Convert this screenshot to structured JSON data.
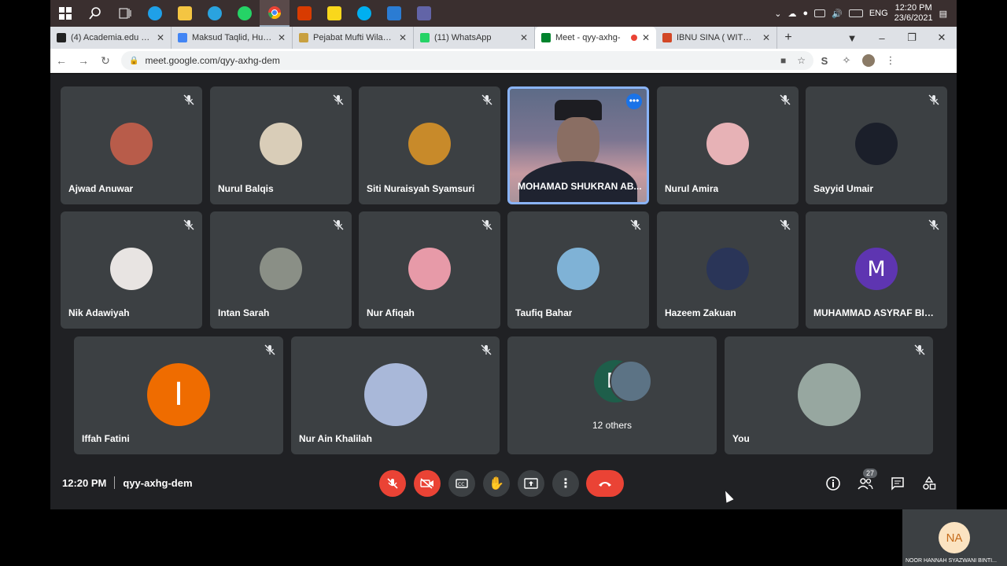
{
  "taskbar": {
    "apps": [
      {
        "name": "windows-start",
        "color": "#ffffff"
      },
      {
        "name": "search",
        "color": "#ffffff"
      },
      {
        "name": "task-view",
        "color": "#ffffff"
      },
      {
        "name": "edge",
        "color": "#1fa0e8"
      },
      {
        "name": "file-explorer",
        "color": "#f4c542"
      },
      {
        "name": "telegram",
        "color": "#2aa3df"
      },
      {
        "name": "whatsapp",
        "color": "#25d366"
      },
      {
        "name": "chrome",
        "color": "#ea4335"
      },
      {
        "name": "office",
        "color": "#d83b01"
      },
      {
        "name": "sticky-notes",
        "color": "#f9d71c"
      },
      {
        "name": "skype",
        "color": "#00aff0"
      },
      {
        "name": "word",
        "color": "#2b7cd3"
      },
      {
        "name": "teams",
        "color": "#6264a7"
      }
    ],
    "language": "ENG",
    "time": "12:20 PM",
    "date": "23/6/2021"
  },
  "tabs": [
    {
      "title": "(4) Academia.edu | Se",
      "favicon": "#222222",
      "active": false
    },
    {
      "title": "Maksud Taqlid, Hukum",
      "favicon": "#4285f4",
      "active": false
    },
    {
      "title": "Pejabat Mufti Wilayah",
      "favicon": "#c8a040",
      "active": false
    },
    {
      "title": "(11) WhatsApp",
      "favicon": "#25d366",
      "active": false
    },
    {
      "title": "Meet - qyy-axhg-",
      "favicon": "#00832d",
      "active": true
    },
    {
      "title": "IBNU SINA ( WITH MC",
      "favicon": "#d24726",
      "active": false
    }
  ],
  "address": {
    "url": "meet.google.com/qyy-axhg-dem"
  },
  "participants": [
    {
      "name": "Ajwad Anuwar",
      "avatar_color": "#b85c4a",
      "avatar_letter": ""
    },
    {
      "name": "Nurul Balqis",
      "avatar_color": "#d9cdb8",
      "avatar_letter": ""
    },
    {
      "name": "Siti Nuraisyah Syamsuri",
      "avatar_color": "#c88a2a",
      "avatar_letter": ""
    },
    {
      "name": "MOHAMAD SHUKRAN AB...",
      "avatar_color": "",
      "avatar_letter": ""
    },
    {
      "name": "Nurul Amira",
      "avatar_color": "#e7b2b6",
      "avatar_letter": ""
    },
    {
      "name": "Sayyid Umair",
      "avatar_color": "#1b1f2a",
      "avatar_letter": ""
    },
    {
      "name": "Nik Adawiyah",
      "avatar_color": "#e8e4e2",
      "avatar_letter": ""
    },
    {
      "name": "Intan Sarah",
      "avatar_color": "#8a8f86",
      "avatar_letter": ""
    },
    {
      "name": "Nur Afiqah",
      "avatar_color": "#e79aa8",
      "avatar_letter": ""
    },
    {
      "name": "Taufiq Bahar",
      "avatar_color": "#7fb2d6",
      "avatar_letter": ""
    },
    {
      "name": "Hazeem Zakuan",
      "avatar_color": "#2a3558",
      "avatar_letter": ""
    },
    {
      "name": "MUHAMMAD ASYRAF BIN ...",
      "avatar_color": "#5e35b1",
      "avatar_letter": "M"
    },
    {
      "name": "Iffah Fatini",
      "avatar_color": "#ef6c00",
      "avatar_letter": "I"
    },
    {
      "name": "Nur Ain Khalilah",
      "avatar_color": "#a9b8d9",
      "avatar_letter": ""
    },
    {
      "name": "12 others",
      "avatar_color": "#1e5e4a",
      "avatar_letter": "M"
    },
    {
      "name": "You",
      "avatar_color": "#97a7a0",
      "avatar_letter": ""
    }
  ],
  "meeting": {
    "time": "12:20 PM",
    "code": "qyy-axhg-dem",
    "participant_count": "27"
  },
  "self_preview": {
    "initials": "NA",
    "name": "NOOR HANNAH SYAZWANI BINTI..."
  }
}
